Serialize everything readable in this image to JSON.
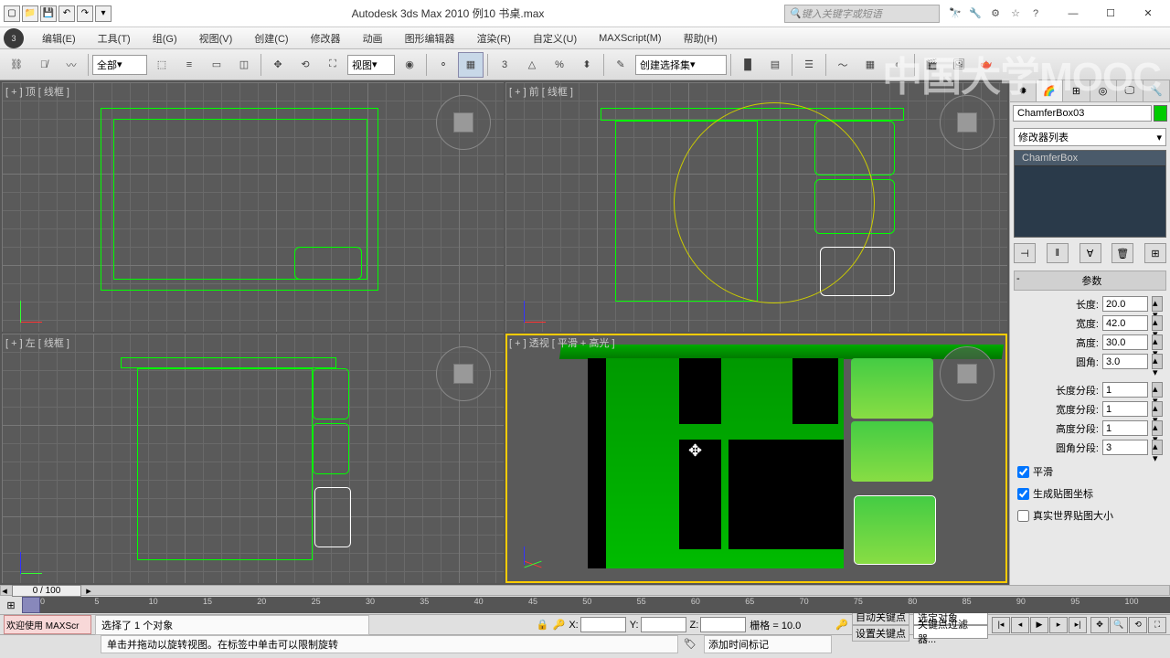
{
  "title": "Autodesk 3ds Max  2010        例10  书桌.max",
  "search_placeholder": "键入关键字或短语",
  "menu": [
    "编辑(E)",
    "工具(T)",
    "组(G)",
    "视图(V)",
    "创建(C)",
    "修改器",
    "动画",
    "图形编辑器",
    "渲染(R)",
    "自定义(U)",
    "MAXScript(M)",
    "帮助(H)"
  ],
  "toolbar_dd1": "全部",
  "toolbar_dd2": "视图",
  "toolbar_dd3": "创建选择集",
  "viewports": {
    "top": "[ + ] 顶 [ 线框 ]",
    "front": "[ + ] 前 [ 线框 ]",
    "left": "[ + ] 左 [ 线框 ]",
    "persp": "[ + ] 透视 [ 平滑 + 高光 ]"
  },
  "side": {
    "obj_name": "ChamferBox03",
    "mod_dd": "修改器列表",
    "stack_item": "ChamferBox",
    "section": "参数",
    "params": [
      {
        "label": "长度:",
        "val": "20.0"
      },
      {
        "label": "宽度:",
        "val": "42.0"
      },
      {
        "label": "高度:",
        "val": "30.0"
      },
      {
        "label": "圆角:",
        "val": "3.0"
      }
    ],
    "segs": [
      {
        "label": "长度分段:",
        "val": "1"
      },
      {
        "label": "宽度分段:",
        "val": "1"
      },
      {
        "label": "高度分段:",
        "val": "1"
      },
      {
        "label": "圆角分段:",
        "val": "3"
      }
    ],
    "checks": [
      {
        "label": "平滑",
        "checked": true
      },
      {
        "label": "生成贴图坐标",
        "checked": true
      },
      {
        "label": "真实世界贴图大小",
        "checked": false
      }
    ]
  },
  "timeline": {
    "frame": "0 / 100",
    "ticks": [
      0,
      5,
      10,
      15,
      20,
      25,
      30,
      35,
      40,
      45,
      50,
      55,
      60,
      65,
      70,
      75,
      80,
      85,
      90,
      95,
      100
    ]
  },
  "status": {
    "prompt1": "选择了 1 个对象",
    "grid": "栅格 = 10.0",
    "auto": "自动关键点",
    "set": "设置关键点",
    "sel_dd": "选定对象",
    "filter": "关键点过滤器...",
    "welcome": "欢迎使用 MAXScr",
    "hint": "单击并拖动以旋转视图。在标签中单击可以限制旋转",
    "addtime": "添加时间标记"
  },
  "watermark": "中国大学MOOC",
  "coords": {
    "x": "X:",
    "y": "Y:",
    "z": "Z:"
  }
}
